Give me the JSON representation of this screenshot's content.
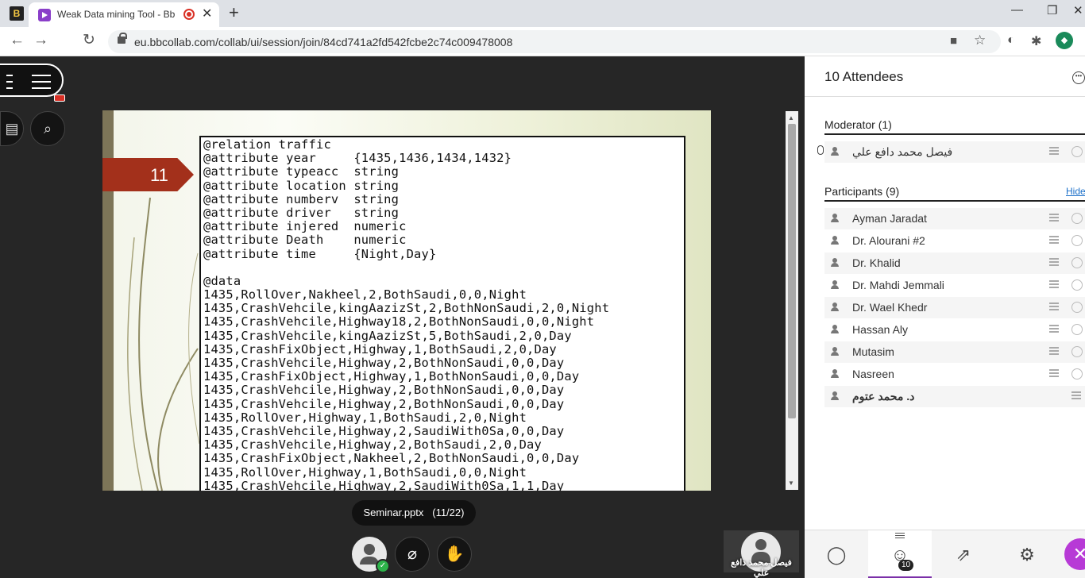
{
  "browser": {
    "pinned_tab_letter": "B",
    "active_tab_title": "Weak Data mining Tool - Bb",
    "tab_close": "✕",
    "new_tab": "+",
    "url": "eu.bbcollab.com/collab/ui/session/join/84cd741a2fd542fcbe2c74c009478008",
    "profile_initial": "◆",
    "win_min": "—",
    "win_restore": "❐",
    "win_close": "✕"
  },
  "stage": {
    "slide_number": "11",
    "code_lines": [
      "@relation traffic",
      "@attribute year     {1435,1436,1434,1432}",
      "@attribute typeacc  string",
      "@attribute location string",
      "@attribute numberv  string",
      "@attribute driver   string",
      "@attribute injered  numeric",
      "@attribute Death    numeric",
      "@attribute time     {Night,Day}",
      "",
      "@data",
      "1435,RollOver,Nakheel,2,BothSaudi,0,0,Night",
      "1435,CrashVehcile,kingAazizSt,2,BothNonSaudi,2,0,Night",
      "1435,CrashVehcile,Highway18,2,BothNonSaudi,0,0,Night",
      "1435,CrashVehcile,kingAazizSt,5,BothSaudi,2,0,Day",
      "1435,CrashFixObject,Highway,1,BothSaudi,2,0,Day",
      "1435,CrashVehcile,Highway,2,BothNonSaudi,0,0,Day",
      "1435,CrashFixObject,Highway,1,BothNonSaudi,0,0,Day",
      "1435,CrashVehcile,Highway,2,BothNonSaudi,0,0,Day",
      "1435,CrashVehcile,Highway,2,BothNonSaudi,0,0,Day",
      "1435,RollOver,Highway,1,BothSaudi,2,0,Night",
      "1435,CrashVehcile,Highway,2,SaudiWith0Sa,0,0,Day",
      "1435,CrashVehcile,Highway,2,BothSaudi,2,0,Day",
      "1435,CrashFixObject,Nakheel,2,BothNonSaudi,0,0,Day",
      "1435,RollOver,Highway,1,BothSaudi,0,0,Night",
      "1435,CrashVehcile,Highway,2,SaudiWith0Sa,1,1,Day"
    ],
    "file_label": "Seminar.pptx",
    "page_indicator": "(11/22)",
    "self_name": "فيصل محمد دافع علي",
    "scroll_position_fraction": 0.0
  },
  "panel": {
    "title": "10 Attendees",
    "moderator_header": "Moderator (1)",
    "moderator_name": "فيصل محمد دافع علي",
    "participants_header": "Participants (9)",
    "hide_link": "Hide",
    "participants": [
      "Ayman Jaradat",
      "Dr. Alourani #2",
      "Dr. Khalid",
      "Dr. Mahdi Jemmali",
      "Dr. Wael Khedr",
      "Hassan Aly",
      "Mutasim",
      "Nasreen",
      "د. محمد عتوم"
    ],
    "attendee_badge": "10"
  },
  "colors": {
    "accent_purple": "#b73ad6",
    "slide_arrow": "#a3301b",
    "online_green": "#2db34a"
  }
}
